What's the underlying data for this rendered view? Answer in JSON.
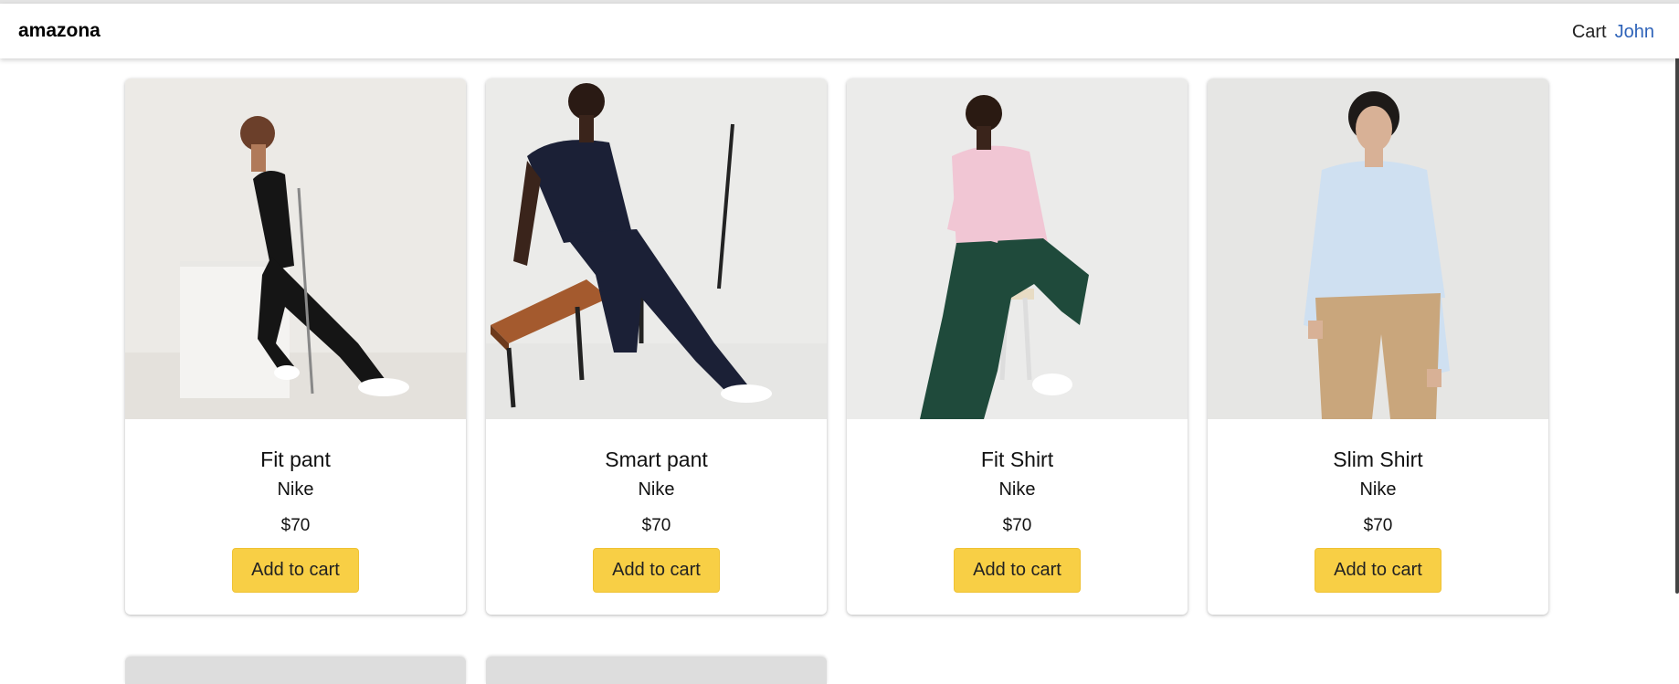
{
  "navbar": {
    "brand": "amazona",
    "cart_label": "Cart",
    "user_label": "John"
  },
  "colors": {
    "accent_button": "#f8cf45",
    "user_link": "#2e63b9"
  },
  "products": [
    {
      "name": "Fit pant",
      "brand": "Nike",
      "price": "$70",
      "button": "Add to cart",
      "image": "model in black polo and black pants seated on white box with golf club"
    },
    {
      "name": "Smart pant",
      "brand": "Nike",
      "price": "$70",
      "button": "Add to cart",
      "image": "model in navy polo and navy pants seated on wooden slat bench"
    },
    {
      "name": "Fit Shirt",
      "brand": "Nike",
      "price": "$70",
      "button": "Add to cart",
      "image": "model in pink shirt and green trousers seated on stool"
    },
    {
      "name": "Slim Shirt",
      "brand": "Nike",
      "price": "$70",
      "button": "Add to cart",
      "image": "model in light blue shirt and beige trousers standing"
    }
  ]
}
